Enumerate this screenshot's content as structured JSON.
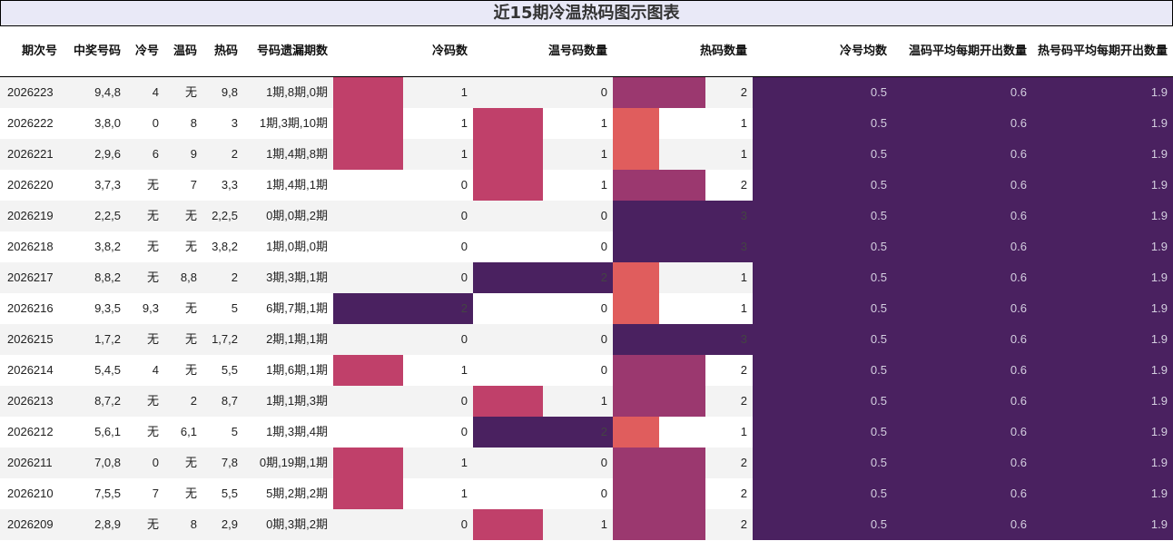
{
  "title": "近15期冷温热码图示图表",
  "headers": [
    "期次号",
    "中奖号码",
    "冷号",
    "温码",
    "热码",
    "号码遗漏期数",
    "冷码数",
    "温号码数量",
    "热码数量",
    "冷号均数",
    "温码平均每期开出数量",
    "热号码平均每期开出数量"
  ],
  "colors": {
    "level_0": "#ffffff",
    "level_1": "#c0406a",
    "level_2": "#4a2160",
    "hot_1": "#e05d5d",
    "hot_2": "#9b386f",
    "hot_3": "#4a2160",
    "avg": "#4a2160"
  },
  "chart_data": {
    "type": "table",
    "columns": [
      "期次号",
      "中奖号码",
      "冷号",
      "温码",
      "热码",
      "号码遗漏期数",
      "冷码数",
      "温号码数量",
      "热码数量",
      "冷号均数",
      "温码平均每期开出数量",
      "热号码平均每期开出数量"
    ],
    "rows": [
      [
        "2026223",
        "9,4,8",
        "4",
        "无",
        "9,8",
        "1期,8期,0期",
        1,
        0,
        2,
        "0.5",
        "0.6",
        "1.9"
      ],
      [
        "2026222",
        "3,8,0",
        "0",
        "8",
        "3",
        "1期,3期,10期",
        1,
        1,
        1,
        "0.5",
        "0.6",
        "1.9"
      ],
      [
        "2026221",
        "2,9,6",
        "6",
        "9",
        "2",
        "1期,4期,8期",
        1,
        1,
        1,
        "0.5",
        "0.6",
        "1.9"
      ],
      [
        "2026220",
        "3,7,3",
        "无",
        "7",
        "3,3",
        "1期,4期,1期",
        0,
        1,
        2,
        "0.5",
        "0.6",
        "1.9"
      ],
      [
        "2026219",
        "2,2,5",
        "无",
        "无",
        "2,2,5",
        "0期,0期,2期",
        0,
        0,
        3,
        "0.5",
        "0.6",
        "1.9"
      ],
      [
        "2026218",
        "3,8,2",
        "无",
        "无",
        "3,8,2",
        "1期,0期,0期",
        0,
        0,
        3,
        "0.5",
        "0.6",
        "1.9"
      ],
      [
        "2026217",
        "8,8,2",
        "无",
        "8,8",
        "2",
        "3期,3期,1期",
        0,
        2,
        1,
        "0.5",
        "0.6",
        "1.9"
      ],
      [
        "2026216",
        "9,3,5",
        "9,3",
        "无",
        "5",
        "6期,7期,1期",
        2,
        0,
        1,
        "0.5",
        "0.6",
        "1.9"
      ],
      [
        "2026215",
        "1,7,2",
        "无",
        "无",
        "1,7,2",
        "2期,1期,1期",
        0,
        0,
        3,
        "0.5",
        "0.6",
        "1.9"
      ],
      [
        "2026214",
        "5,4,5",
        "4",
        "无",
        "5,5",
        "1期,6期,1期",
        1,
        0,
        2,
        "0.5",
        "0.6",
        "1.9"
      ],
      [
        "2026213",
        "8,7,2",
        "无",
        "2",
        "8,7",
        "1期,1期,3期",
        0,
        1,
        2,
        "0.5",
        "0.6",
        "1.9"
      ],
      [
        "2026212",
        "5,6,1",
        "无",
        "6,1",
        "5",
        "1期,3期,4期",
        0,
        2,
        1,
        "0.5",
        "0.6",
        "1.9"
      ],
      [
        "2026211",
        "7,0,8",
        "0",
        "无",
        "7,8",
        "0期,19期,1期",
        1,
        0,
        2,
        "0.5",
        "0.6",
        "1.9"
      ],
      [
        "2026210",
        "7,5,5",
        "7",
        "无",
        "5,5",
        "5期,2期,2期",
        1,
        0,
        2,
        "0.5",
        "0.6",
        "1.9"
      ],
      [
        "2026209",
        "2,8,9",
        "无",
        "8",
        "2,9",
        "0期,3期,2期",
        0,
        1,
        2,
        "0.5",
        "0.6",
        "1.9"
      ]
    ]
  }
}
